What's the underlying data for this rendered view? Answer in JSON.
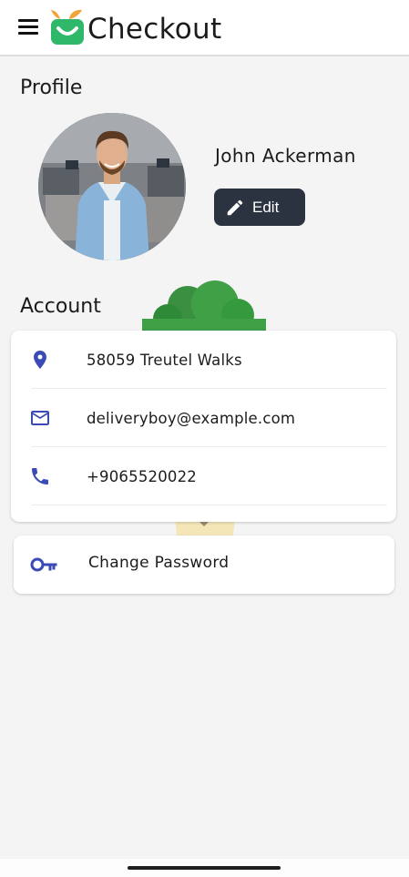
{
  "app_bar": {
    "brand": "Checkout",
    "menu_icon": "menu-icon",
    "logo_icon": "shopping-bag-logo-icon"
  },
  "profile": {
    "title": "Profile",
    "name": "John Ackerman",
    "edit_label": "Edit",
    "edit_icon": "pencil-icon"
  },
  "account": {
    "title": "Account",
    "rows": [
      {
        "icon": "location-pin-icon",
        "value": "58059 Treutel Walks"
      },
      {
        "icon": "mail-icon",
        "value": "deliveryboy@example.com"
      },
      {
        "icon": "phone-icon",
        "value": "+9065520022"
      }
    ]
  },
  "password": {
    "label": "Change Password",
    "icon": "key-icon"
  },
  "colors": {
    "accent_icon": "#3a4bb5",
    "edit_button_bg": "#2b3240",
    "logo_green": "#2fb76a",
    "logo_orange": "#f2a33a",
    "bush_green": "#3fa046"
  }
}
